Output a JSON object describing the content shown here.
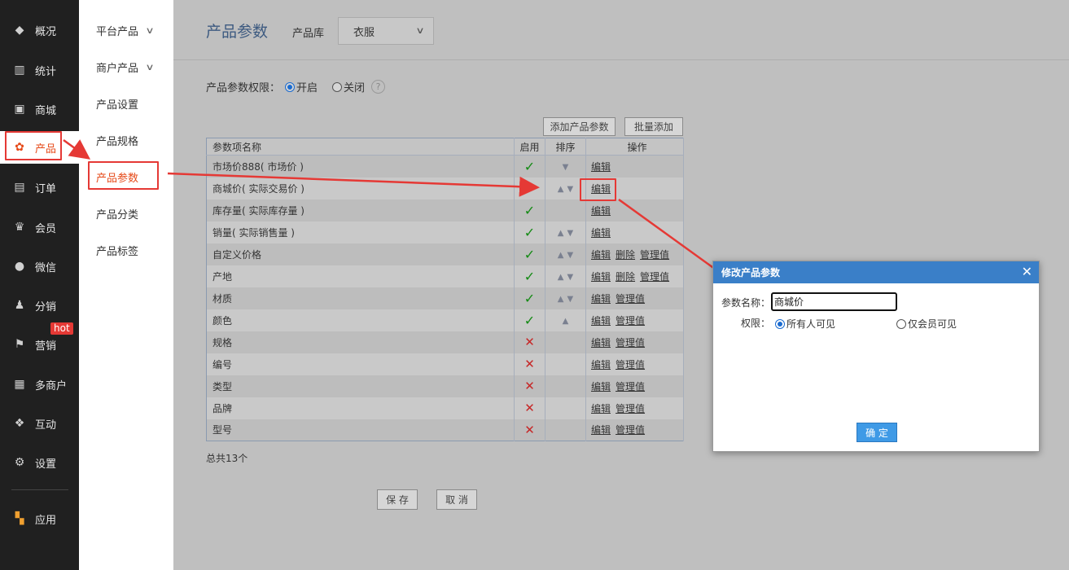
{
  "sidebar": {
    "items": [
      {
        "label": "概况",
        "icon": "layers-icon"
      },
      {
        "label": "统计",
        "icon": "chart-icon"
      },
      {
        "label": "商城",
        "icon": "mail-icon"
      },
      {
        "label": "产品",
        "icon": "grid-icon"
      },
      {
        "label": "订单",
        "icon": "clipboard-icon"
      },
      {
        "label": "会员",
        "icon": "crown-icon"
      },
      {
        "label": "微信",
        "icon": "chat-icon"
      },
      {
        "label": "分销",
        "icon": "users-icon"
      },
      {
        "label": "营销",
        "icon": "flag-icon"
      },
      {
        "label": "多商户",
        "icon": "store-icon"
      },
      {
        "label": "互动",
        "icon": "interact-icon"
      },
      {
        "label": "设置",
        "icon": "gear-icon"
      },
      {
        "label": "应用",
        "icon": "apps-icon"
      }
    ],
    "hot_badge": "hot"
  },
  "subnav": {
    "items": [
      "平台产品",
      "商户产品",
      "产品设置",
      "产品规格",
      "产品参数",
      "产品分类",
      "产品标签"
    ]
  },
  "header": {
    "title": "产品参数",
    "library_label": "产品库",
    "library_value": "衣服"
  },
  "permission": {
    "label": "产品参数权限：",
    "on": "开启",
    "off": "关闭",
    "help": "?"
  },
  "buttons": {
    "add": "添加产品参数",
    "batch_add": "批量添加",
    "save": "保 存",
    "cancel": "取 消"
  },
  "table": {
    "headers": [
      "参数项名称",
      "启用",
      "排序",
      "操作"
    ],
    "rows": [
      {
        "name": "市场价888( 市场价 )",
        "enabled": true,
        "up": false,
        "down": true,
        "actions": [
          "编辑"
        ]
      },
      {
        "name": "商城价( 实际交易价 )",
        "enabled": true,
        "up": true,
        "down": true,
        "actions": [
          "编辑"
        ]
      },
      {
        "name": "库存量( 实际库存量 )",
        "enabled": true,
        "up": false,
        "down": false,
        "actions": [
          "编辑"
        ]
      },
      {
        "name": "销量( 实际销售量 )",
        "enabled": true,
        "up": true,
        "down": true,
        "actions": [
          "编辑"
        ]
      },
      {
        "name": "自定义价格",
        "enabled": true,
        "up": true,
        "down": true,
        "actions": [
          "编辑",
          "删除",
          "管理值"
        ]
      },
      {
        "name": "产地",
        "enabled": true,
        "up": true,
        "down": true,
        "actions": [
          "编辑",
          "删除",
          "管理值"
        ]
      },
      {
        "name": "材质",
        "enabled": true,
        "up": true,
        "down": true,
        "actions": [
          "编辑",
          "管理值"
        ]
      },
      {
        "name": "颜色",
        "enabled": true,
        "up": true,
        "down": false,
        "actions": [
          "编辑",
          "管理值"
        ]
      },
      {
        "name": "规格",
        "enabled": false,
        "up": false,
        "down": false,
        "actions": [
          "编辑",
          "管理值"
        ]
      },
      {
        "name": "编号",
        "enabled": false,
        "up": false,
        "down": false,
        "actions": [
          "编辑",
          "管理值"
        ]
      },
      {
        "name": "类型",
        "enabled": false,
        "up": false,
        "down": false,
        "actions": [
          "编辑",
          "管理值"
        ]
      },
      {
        "name": "品牌",
        "enabled": false,
        "up": false,
        "down": false,
        "actions": [
          "编辑",
          "管理值"
        ]
      },
      {
        "name": "型号",
        "enabled": false,
        "up": false,
        "down": false,
        "actions": [
          "编辑",
          "管理值"
        ]
      }
    ],
    "total": "总共13个"
  },
  "dialog": {
    "title": "修改产品参数",
    "name_label": "参数名称：",
    "name_value": "商城价",
    "perm_label": "权限：",
    "opt_all": "所有人可见",
    "opt_member": "仅会员可见",
    "ok": "确 定"
  },
  "colors": {
    "accent": "#e64a19",
    "annotation": "#e53935",
    "dialog_header": "#3a7fc8"
  }
}
